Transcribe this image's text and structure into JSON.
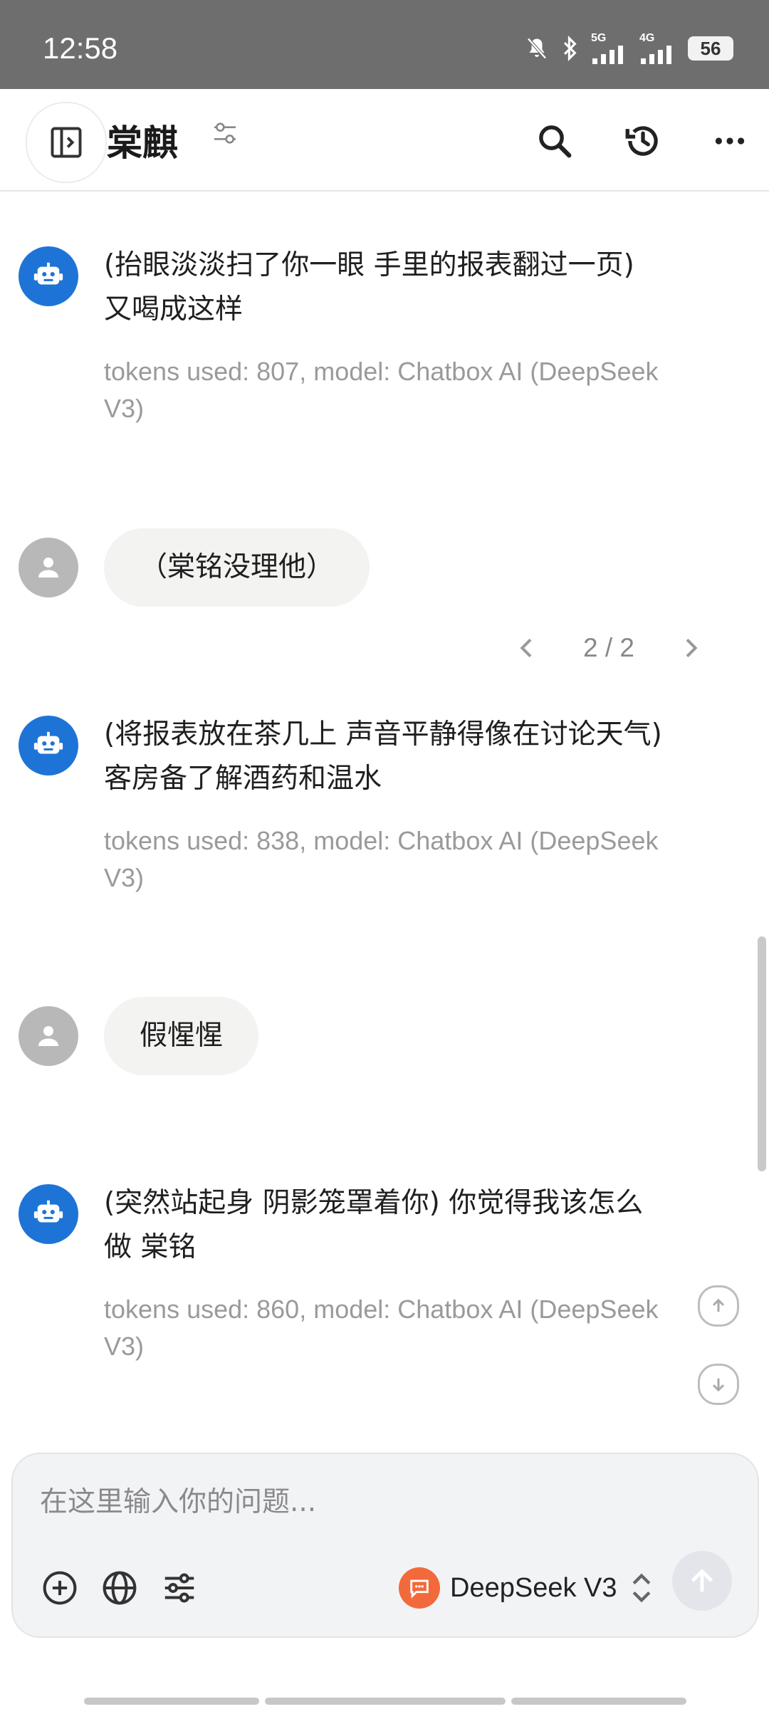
{
  "status_bar": {
    "time": "12:58",
    "signal_1": "5G",
    "signal_2": "4G",
    "battery": "56"
  },
  "header": {
    "title": "棠麒"
  },
  "messages": [
    {
      "role": "assistant",
      "lines": [
        "(抬眼淡淡扫了你一眼 手里的报表翻过一页)",
        "又喝成这样"
      ],
      "meta_lines": [
        "tokens used: 807, model: Chatbox AI (DeepSeek",
        "V3)"
      ]
    },
    {
      "role": "user",
      "text": "（棠铭没理他）"
    },
    {
      "role": "assistant",
      "lines": [
        "(将报表放在茶几上 声音平静得像在讨论天气)",
        "客房备了解酒药和温水"
      ],
      "meta_lines": [
        "tokens used: 838, model: Chatbox AI (DeepSeek",
        "V3)"
      ]
    },
    {
      "role": "user",
      "text": "假惺惺"
    },
    {
      "role": "assistant",
      "lines": [
        "(突然站起身 阴影笼罩着你) 你觉得我该怎么",
        "做 棠铭"
      ],
      "meta_lines": [
        "tokens used: 860, model: Chatbox AI (DeepSeek",
        "V3)"
      ]
    }
  ],
  "pager": {
    "text": "2 / 2"
  },
  "composer": {
    "placeholder": "在这里输入你的问题...",
    "model_name": "DeepSeek V3"
  },
  "colors": {
    "bot_avatar": "#1e74d6",
    "user_avatar": "#b8b8b8",
    "model_icon": "#f26a3b",
    "status_bar": "#6e6e6e"
  }
}
